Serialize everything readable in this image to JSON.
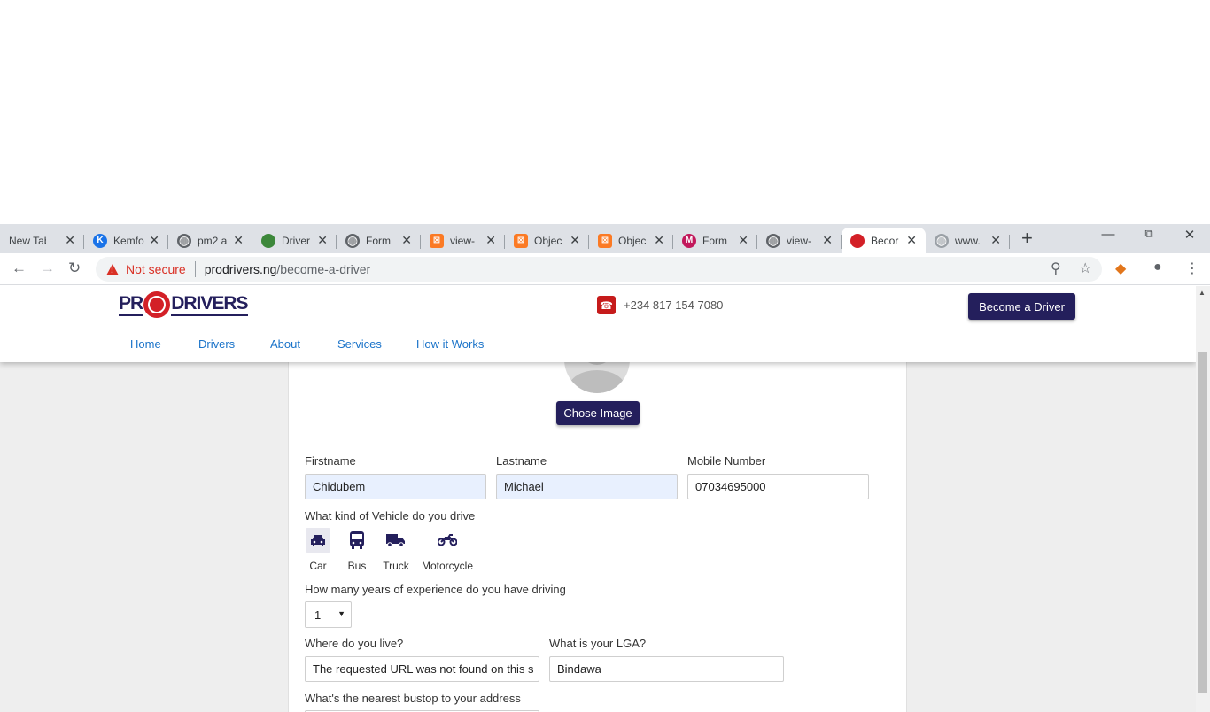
{
  "browser": {
    "tabs": [
      {
        "title": "New Tab",
        "icon": "none",
        "color": "#dee1e6"
      },
      {
        "title": "Kemfo",
        "icon": "k-icon",
        "color": "#1a73e8"
      },
      {
        "title": "pm2 a",
        "icon": "globe-icon",
        "color": "#5f6368"
      },
      {
        "title": "Driver",
        "icon": "nodejs-icon",
        "color": "#3c873a"
      },
      {
        "title": "Form",
        "icon": "globe-icon",
        "color": "#5f6368"
      },
      {
        "title": "view-",
        "icon": "xampp-icon",
        "color": "#fb7a24"
      },
      {
        "title": "Objec",
        "icon": "xampp-icon",
        "color": "#fb7a24"
      },
      {
        "title": "Objec",
        "icon": "xampp-icon",
        "color": "#fb7a24"
      },
      {
        "title": "Form",
        "icon": "m-icon",
        "color": "#c2185b"
      },
      {
        "title": "view-",
        "icon": "globe-icon",
        "color": "#5f6368"
      },
      {
        "title": "Becor",
        "icon": "prodrivers-icon",
        "color": "#d32027",
        "active": true
      },
      {
        "title": "www.",
        "icon": "globe-icon",
        "color": "#9aa0a6"
      }
    ],
    "tab_close": "✕",
    "new_tab": "+",
    "security_label": "Not secure",
    "url_host": "prodrivers.ng",
    "url_path": "/become-a-driver"
  },
  "header": {
    "logo_left": "PR",
    "logo_right": "DRIVERS",
    "phone": "+234 817 154 7080",
    "become_driver_label": "Become a Driver",
    "menu": [
      "Home",
      "Drivers",
      "About",
      "Services",
      "How it Works"
    ]
  },
  "form": {
    "chose_image_label": "Chose Image",
    "firstname_label": "Firstname",
    "firstname_value": "Chidubem",
    "lastname_label": "Lastname",
    "lastname_value": "Michael",
    "mobile_label": "Mobile Number",
    "mobile_value": "07034695000",
    "vehicle_question": "What kind of Vehicle do you drive",
    "vehicles": [
      "Car",
      "Bus",
      "Truck",
      "Motorcycle"
    ],
    "experience_question": "How many years of experience do you have driving",
    "experience_value": "1",
    "live_label": "Where do you live?",
    "live_value": "The requested URL was not found on this s",
    "lga_label": "What is your LGA?",
    "lga_value": "Bindawa",
    "bustop_label": "What's the nearest bustop to your address"
  },
  "colors": {
    "brand": "#241f5c",
    "logo_red": "#d32027",
    "link": "#1a73c9"
  }
}
